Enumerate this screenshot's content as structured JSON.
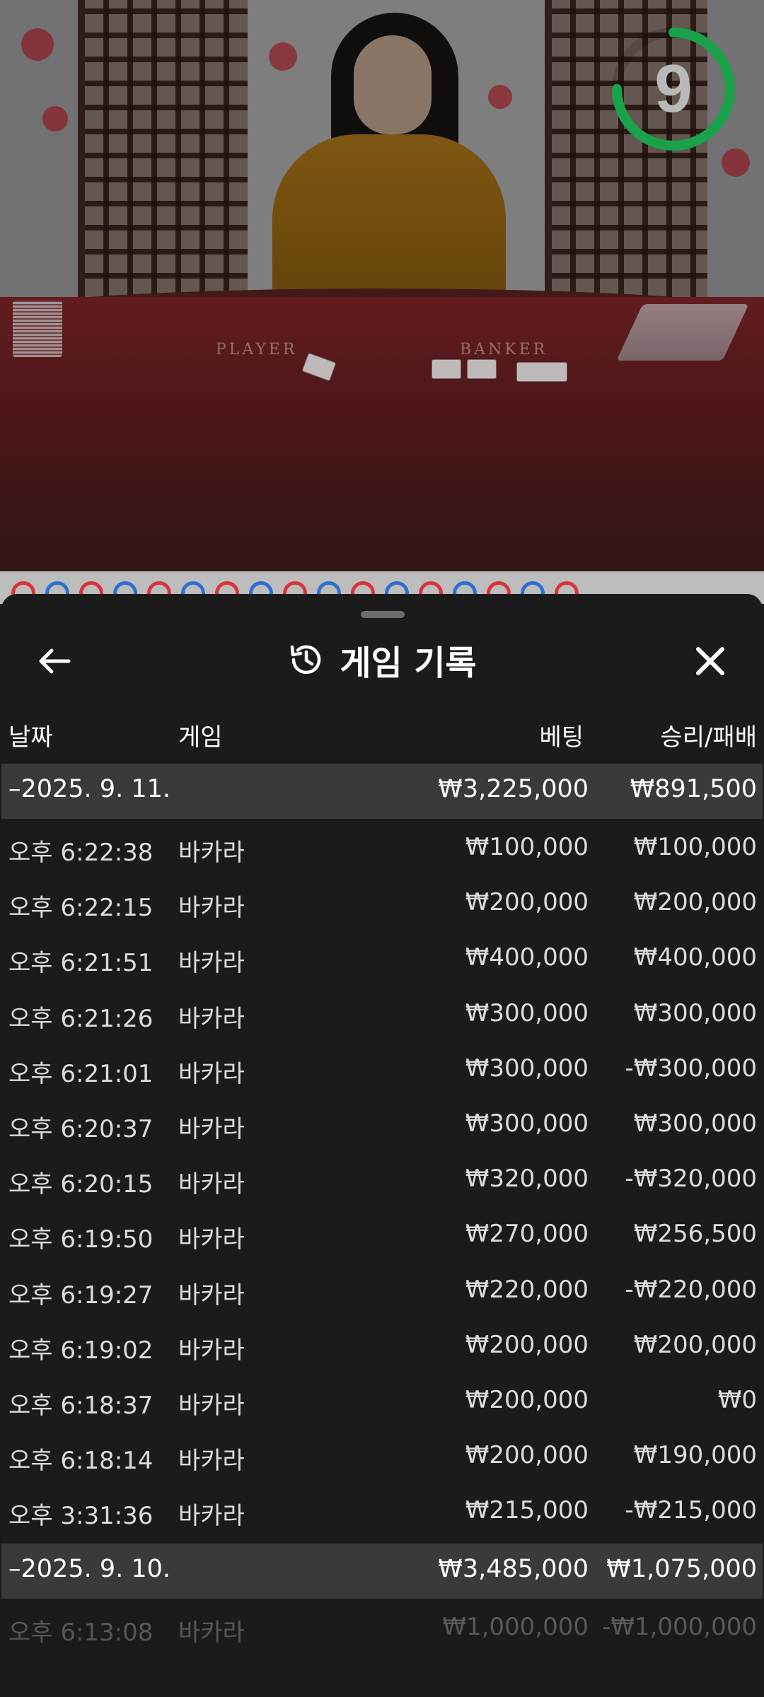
{
  "timer": {
    "value": "9",
    "progress": 0.75,
    "color": "#1aa24a"
  },
  "sheet": {
    "title": "게임 기록",
    "icons": {
      "back": "back-arrow-icon",
      "history": "history-icon",
      "close": "close-icon"
    }
  },
  "columns": {
    "date": "날짜",
    "game": "게임",
    "bet": "베팅",
    "winloss": "승리/패배"
  },
  "groups": [
    {
      "date": "–2025. 9. 11.",
      "total_bet": "₩3,225,000",
      "total_winloss": "₩891,500",
      "rows": [
        {
          "time": "오후 6:22:38",
          "game": "바카라",
          "bet": "₩100,000",
          "winloss": "₩100,000"
        },
        {
          "time": "오후 6:22:15",
          "game": "바카라",
          "bet": "₩200,000",
          "winloss": "₩200,000"
        },
        {
          "time": "오후 6:21:51",
          "game": "바카라",
          "bet": "₩400,000",
          "winloss": "₩400,000"
        },
        {
          "time": "오후 6:21:26",
          "game": "바카라",
          "bet": "₩300,000",
          "winloss": "₩300,000"
        },
        {
          "time": "오후 6:21:01",
          "game": "바카라",
          "bet": "₩300,000",
          "winloss": "-₩300,000"
        },
        {
          "time": "오후 6:20:37",
          "game": "바카라",
          "bet": "₩300,000",
          "winloss": "₩300,000"
        },
        {
          "time": "오후 6:20:15",
          "game": "바카라",
          "bet": "₩320,000",
          "winloss": "-₩320,000"
        },
        {
          "time": "오후 6:19:50",
          "game": "바카라",
          "bet": "₩270,000",
          "winloss": "₩256,500"
        },
        {
          "time": "오후 6:19:27",
          "game": "바카라",
          "bet": "₩220,000",
          "winloss": "-₩220,000"
        },
        {
          "time": "오후 6:19:02",
          "game": "바카라",
          "bet": "₩200,000",
          "winloss": "₩200,000"
        },
        {
          "time": "오후 6:18:37",
          "game": "바카라",
          "bet": "₩200,000",
          "winloss": "₩0"
        },
        {
          "time": "오후 6:18:14",
          "game": "바카라",
          "bet": "₩200,000",
          "winloss": "₩190,000"
        },
        {
          "time": "오후 3:31:36",
          "game": "바카라",
          "bet": "₩215,000",
          "winloss": "-₩215,000"
        }
      ]
    },
    {
      "date": "–2025. 9. 10.",
      "total_bet": "₩3,485,000",
      "total_winloss": "₩1,075,000",
      "rows": [
        {
          "time": "오후 6:13:08",
          "game": "바카라",
          "bet": "₩1,000,000",
          "winloss": "-₩1,000,000"
        }
      ]
    }
  ],
  "video": {
    "table_labels": {
      "player": "PLAYER",
      "banker": "BANKER"
    }
  },
  "roadmap": {
    "results": [
      "banker",
      "player",
      "banker",
      "player",
      "banker",
      "player",
      "banker",
      "player",
      "banker",
      "player",
      "banker",
      "player",
      "banker",
      "player",
      "banker",
      "player",
      "banker"
    ],
    "colors": {
      "banker": "#d8343c",
      "player": "#2f6fd0"
    }
  }
}
